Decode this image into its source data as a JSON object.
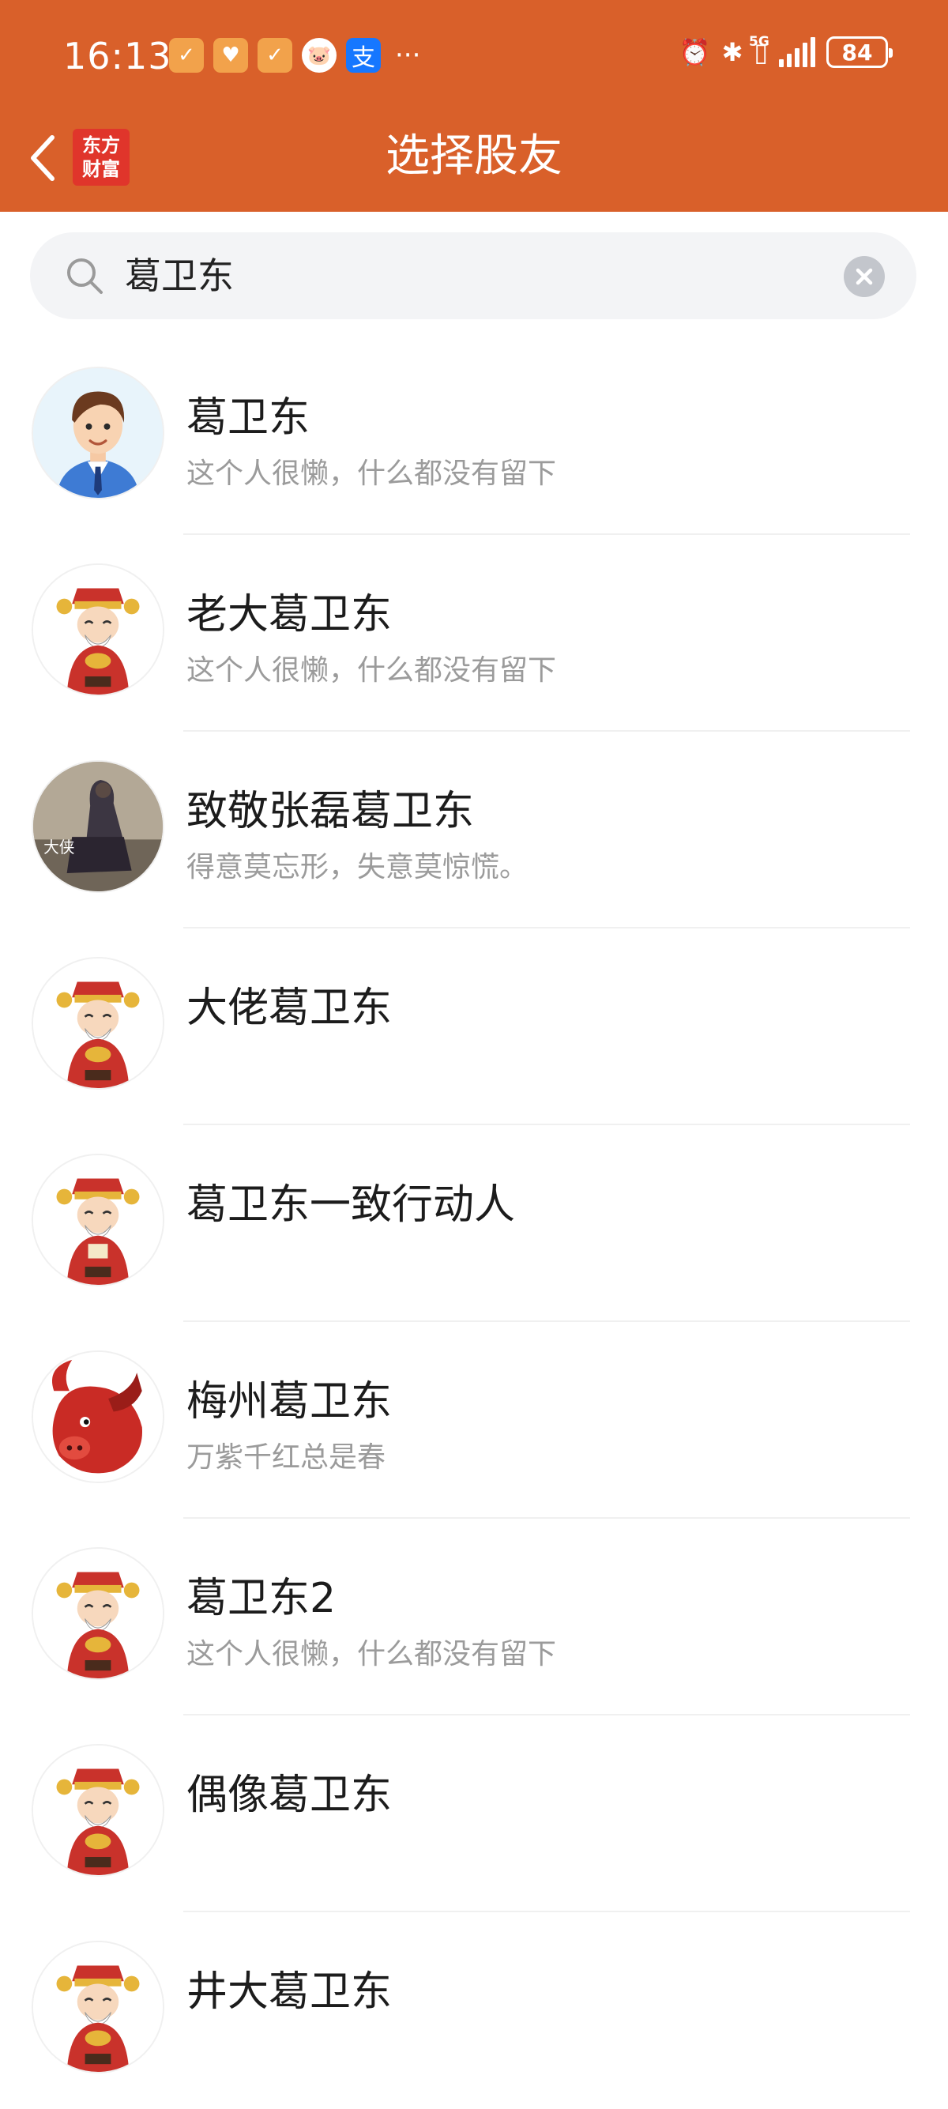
{
  "status_bar": {
    "time": "16:13",
    "notif_more": "···",
    "notif_alipay": "支",
    "battery": "84",
    "network": "5G"
  },
  "nav": {
    "title": "选择股友",
    "logo_line1": "东方",
    "logo_line2": "财富"
  },
  "search": {
    "value": "葛卫东",
    "placeholder": ""
  },
  "results": [
    {
      "name": "葛卫东",
      "bio": "这个人很懒，什么都没有留下",
      "avatar": "cartoon-man-avatar"
    },
    {
      "name": "老大葛卫东",
      "bio": "这个人很懒，什么都没有留下",
      "avatar": "god-of-wealth-avatar"
    },
    {
      "name": "致敬张磊葛卫东",
      "bio": "得意莫忘形，失意莫惊慌。",
      "avatar": "swordsman-photo-avatar",
      "avatar_text": "大侠"
    },
    {
      "name": "大佬葛卫东",
      "bio": "",
      "avatar": "god-of-wealth-avatar"
    },
    {
      "name": "葛卫东一致行动人",
      "bio": "",
      "avatar": "god-of-wealth-avatar"
    },
    {
      "name": "梅州葛卫东",
      "bio": "万紫千红总是春",
      "avatar": "red-bull-avatar"
    },
    {
      "name": "葛卫东2",
      "bio": "这个人很懒，什么都没有留下",
      "avatar": "god-of-wealth-avatar"
    },
    {
      "name": "偶像葛卫东",
      "bio": "",
      "avatar": "god-of-wealth-avatar"
    },
    {
      "name": "井大葛卫东",
      "bio": "",
      "avatar": "god-of-wealth-avatar"
    }
  ],
  "colors": {
    "header": "#d9602a",
    "search_bg": "#f3f4f6",
    "name_text": "#1c1c1c",
    "bio_text": "#9b9b9b"
  }
}
